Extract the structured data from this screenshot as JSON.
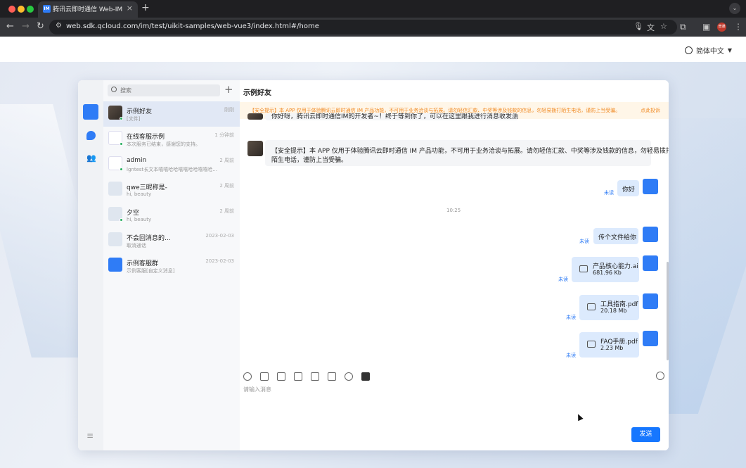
{
  "browser": {
    "tab_title": "腾讯云即时通信 Web-IM",
    "tab_favicon": "IM",
    "url": "web.sdk.qcloud.com/im/test/uikit-samples/web-vue3/index.html#/home",
    "profile_initials": "普通",
    "colors": {
      "tabbar": "#1f1f22",
      "toolbar": "#35363a",
      "close": "#ff5f57",
      "minimize": "#febc2e",
      "zoom": "#28c840"
    }
  },
  "page": {
    "language": "简体中文"
  },
  "conversations": {
    "search_placeholder": "搜索",
    "items": [
      {
        "name": "示例好友",
        "time": "刚刚",
        "last": "[文件]",
        "avatar": "photo",
        "active": true
      },
      {
        "name": "在线客服示例",
        "time": "1 分钟前",
        "last": "本次服务已结束，感谢您的支持。",
        "avatar": "light",
        "active": false
      },
      {
        "name": "admin",
        "time": "2 周前",
        "last": "lgntest长文本嘻嘻哈哈嘻嘻哈哈嘻嘻哈...",
        "avatar": "light",
        "active": false
      },
      {
        "name": "qwe三昵称是-",
        "time": "2 周前",
        "last": "hi, beauty",
        "avatar": "cartoon",
        "active": false
      },
      {
        "name": "夕空",
        "time": "2 周前",
        "last": "hi, beauty",
        "avatar": "cartoon",
        "active": false
      },
      {
        "name": "不会回消息的...",
        "time": "2023-02-03",
        "last": "取消通话",
        "avatar": "cartoon",
        "active": false
      },
      {
        "name": "示例客服群",
        "time": "2023-02-03",
        "last": "示例客服[自定义消息]",
        "avatar": "blue",
        "active": false
      }
    ]
  },
  "chat": {
    "title": "示例好友",
    "notice": "【安全提示】本 APP 仅用于体验腾讯云即时通信 IM 产品功能，不可用于业务洽谈与拓展。请勿轻信汇款、中奖等涉及钱款的信息，勿轻易拨打陌生电话，谨防上当受骗。",
    "notice_link": "点此投诉",
    "messages": {
      "clipped_text": "你好呀，腾讯云即时通信IM的开发者~！终于等到你了，可以在这里跟我进行消息收发测试哦！",
      "safety_line1": "【安全提示】本 APP 仅用于体验腾讯云即时通信 IM 产品功能，不可用于业务洽谈与拓展。请勿轻信汇款、中奖等涉及钱款的信息，勿轻易拨打",
      "safety_line2": "陌生电话，谨防上当受骗。",
      "hello": "你好",
      "timestamp": "10:25",
      "send_file": "传个文件给你",
      "unread": "未读",
      "files": [
        {
          "name": "产品核心能力.ai",
          "size": "681.96 Kb"
        },
        {
          "name": "工具指南.pdf",
          "size": "20.18 Mb"
        },
        {
          "name": "FAQ手册.pdf",
          "size": "2.23 Mb"
        }
      ]
    },
    "composer": {
      "placeholder": "请输入消息",
      "send_label": "发送",
      "tools": [
        "emoji-icon",
        "image-icon",
        "folder-icon",
        "video-icon",
        "camera-icon",
        "evaluate-icon",
        "call-icon",
        "terminal-icon"
      ]
    }
  },
  "colors": {
    "accent": "#1677ff",
    "notice_bg": "#fff6e8",
    "notice_text": "#f08a24",
    "self_bubble": "#dceafd"
  }
}
